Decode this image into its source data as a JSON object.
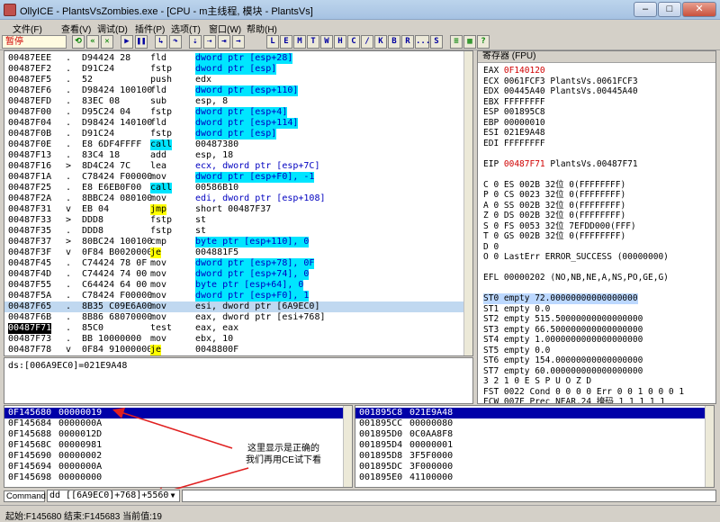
{
  "window": {
    "title": "OllyICE - PlantsVsZombies.exe - [CPU - m主线程, 模块 - PlantsVs]",
    "minimize": "–",
    "maximize": "□",
    "close": "✕"
  },
  "menu": [
    "文件(F)",
    "查看(V)",
    "调试(D)",
    "插件(P)",
    "选项(T)",
    "窗口(W)",
    "帮助(H)"
  ],
  "toolbar": {
    "status": "暂停",
    "letter_buttons": [
      "L",
      "E",
      "M",
      "T",
      "W",
      "H",
      "C",
      "/",
      "K",
      "B",
      "R",
      "...",
      "S"
    ]
  },
  "disasm": [
    {
      "addr": "00487EEE",
      "mark": ".",
      "hex": "D94424 28",
      "mn": "fld",
      "op": "dword ptr [esp+28]",
      "hl": "cyan"
    },
    {
      "addr": "00487EF2",
      "mark": ".",
      "hex": "D91C24",
      "mn": "fstp",
      "op": "dword ptr [esp]",
      "hl": "cyan"
    },
    {
      "addr": "00487EF5",
      "mark": ".",
      "hex": "52",
      "mn": "push",
      "op": "edx",
      "hl": ""
    },
    {
      "addr": "00487EF6",
      "mark": ".",
      "hex": "D98424 100100",
      "mn": "fld",
      "op": "dword ptr [esp+110]",
      "hl": "cyan"
    },
    {
      "addr": "00487EFD",
      "mark": ".",
      "hex": "83EC 08",
      "mn": "sub",
      "op": "esp, 8",
      "hl": ""
    },
    {
      "addr": "00487F00",
      "mark": ".",
      "hex": "D95C24 04",
      "mn": "fstp",
      "op": "dword ptr [esp+4]",
      "hl": "cyan"
    },
    {
      "addr": "00487F04",
      "mark": ".",
      "hex": "D98424 140100",
      "mn": "fld",
      "op": "dword ptr [esp+114]",
      "hl": "cyan"
    },
    {
      "addr": "00487F0B",
      "mark": ".",
      "hex": "D91C24",
      "mn": "fstp",
      "op": "dword ptr [esp]",
      "hl": "cyan"
    },
    {
      "addr": "00487F0E",
      "mark": ".",
      "hex": "E8 6DF4FFFF",
      "mn": "call",
      "op": "00487380",
      "hl": "",
      "mnhl": "cyan"
    },
    {
      "addr": "00487F13",
      "mark": ".",
      "hex": "83C4 18",
      "mn": "add",
      "op": "esp, 18",
      "hl": ""
    },
    {
      "addr": "00487F16",
      "mark": ">",
      "hex": "8D4C24 7C",
      "mn": "lea",
      "op": "ecx, dword ptr [esp+7C]",
      "hl": "cyanpart"
    },
    {
      "addr": "00487F1A",
      "mark": ".",
      "hex": "C78424 F00000",
      "mn": "mov",
      "op": "dword ptr [esp+F0], -1",
      "hl": "cyan"
    },
    {
      "addr": "00487F25",
      "mark": ".",
      "hex": "E8 E6EB0F00",
      "mn": "call",
      "op": "00586B10",
      "hl": "",
      "mnhl": "cyan"
    },
    {
      "addr": "00487F2A",
      "mark": ".",
      "hex": "8BBC24 080100",
      "mn": "mov",
      "op": "edi, dword ptr [esp+108]",
      "hl": "cyanpart"
    },
    {
      "addr": "00487F31",
      "mark": "v",
      "hex": "EB 04",
      "mn": "jmp",
      "op": "short 00487F37",
      "hl": "",
      "mnhl": "yellow"
    },
    {
      "addr": "00487F33",
      "mark": ">",
      "hex": "DDD8",
      "mn": "fstp",
      "op": "st",
      "hl": ""
    },
    {
      "addr": "00487F35",
      "mark": ".",
      "hex": "DDD8",
      "mn": "fstp",
      "op": "st",
      "hl": ""
    },
    {
      "addr": "00487F37",
      "mark": ">",
      "hex": "80BC24 100100",
      "mn": "cmp",
      "op": "byte ptr [esp+110], 0",
      "hl": "cyan"
    },
    {
      "addr": "00487F3F",
      "mark": "v",
      "hex": "0F84 B0020000",
      "mn": "je",
      "op": "004881F5",
      "hl": "",
      "mnhl": "yellow"
    },
    {
      "addr": "00487F45",
      "mark": ".",
      "hex": "C74424 78 0F",
      "mn": "mov",
      "op": "dword ptr [esp+78], 0F",
      "hl": "cyan"
    },
    {
      "addr": "00487F4D",
      "mark": ".",
      "hex": "C74424 74 00",
      "mn": "mov",
      "op": "dword ptr [esp+74], 0",
      "hl": "cyan"
    },
    {
      "addr": "00487F55",
      "mark": ".",
      "hex": "C64424 64 00",
      "mn": "mov",
      "op": "byte ptr [esp+64], 0",
      "hl": "cyan"
    },
    {
      "addr": "00487F5A",
      "mark": ".",
      "hex": "C78424 F00000",
      "mn": "mov",
      "op": "dword ptr [esp+F0], 1",
      "hl": "cyan"
    },
    {
      "addr": "00487F65",
      "mark": ".",
      "hex": "8B35 C09E6A00",
      "mn": "mov",
      "op": "esi, dword ptr [6A9EC0]",
      "hl": "selected"
    },
    {
      "addr": "00487F6B",
      "mark": ".",
      "hex": "8B86 68070000",
      "mn": "mov",
      "op": "eax, dword ptr [esi+768]",
      "hl": ""
    },
    {
      "addr": "00487F71",
      "mark": ".",
      "hex": "85C0",
      "mn": "test",
      "op": "eax, eax",
      "hl": "",
      "addrhl": "black"
    },
    {
      "addr": "00487F73",
      "mark": ".",
      "hex": "BB 10000000",
      "mn": "mov",
      "op": "ebx, 10",
      "hl": ""
    },
    {
      "addr": "00487F78",
      "mark": "v",
      "hex": "0F84 91000000",
      "mn": "je",
      "op": "0048800F",
      "hl": "",
      "mnhl": "yellow"
    }
  ],
  "info_line": "ds:[006A9EC0]=021E9A48",
  "registers": {
    "header": "寄存器 (FPU)",
    "lines": [
      {
        "t": "EAX 0F140120",
        "red": "0F140120"
      },
      {
        "t": "ECX 0061FCF3 PlantsVs.0061FCF3"
      },
      {
        "t": "EDX 00445A40 PlantsVs.00445A40"
      },
      {
        "t": "EBX FFFFFFFF"
      },
      {
        "t": "ESP 001895C8"
      },
      {
        "t": "EBP 00000010"
      },
      {
        "t": "ESI 021E9A48"
      },
      {
        "t": "EDI FFFFFFFF"
      },
      {
        "t": ""
      },
      {
        "t": "EIP 00487F71 PlantsVs.00487F71",
        "red": "00487F71"
      },
      {
        "t": ""
      },
      {
        "t": "C 0   ES 002B 32位 0(FFFFFFFF)"
      },
      {
        "t": "P 0   CS 0023 32位 0(FFFFFFFF)"
      },
      {
        "t": "A 0   SS 002B 32位 0(FFFFFFFF)"
      },
      {
        "t": "Z 0   DS 002B 32位 0(FFFFFFFF)"
      },
      {
        "t": "S 0   FS 0053 32位 7EFDD000(FFF)"
      },
      {
        "t": "T 0   GS 002B 32位 0(FFFFFFFF)"
      },
      {
        "t": "D 0"
      },
      {
        "t": "O 0   LastErr ERROR_SUCCESS (00000000)"
      },
      {
        "t": ""
      },
      {
        "t": "EFL 00000202 (NO,NB,NE,A,NS,PO,GE,G)"
      },
      {
        "t": ""
      },
      {
        "t": "ST0 empty 72.00000000000000000",
        "hl": true
      },
      {
        "t": "ST1 empty 0.0"
      },
      {
        "t": "ST2 empty 515.50000000000000000"
      },
      {
        "t": "ST3 empty 66.500000000000000000"
      },
      {
        "t": "ST4 empty 1.0000000000000000000"
      },
      {
        "t": "ST5 empty 0.0"
      },
      {
        "t": "ST6 empty 154.00000000000000000"
      },
      {
        "t": "ST7 empty 60.000000000000000000"
      },
      {
        "t": "               3 2 1 0      E S P U O Z D"
      },
      {
        "t": "FST 0022  Cond 0 0 0 0  Err 0 0 1 0 0 0 1"
      },
      {
        "t": "FCW 007F  Prec NEAR,24  掩码    1 1 1 1 1"
      }
    ]
  },
  "dump": [
    {
      "a": "0F145680",
      "v": "00000019",
      "sel": true
    },
    {
      "a": "0F145684",
      "v": "0000000A"
    },
    {
      "a": "0F145688",
      "v": "0000012D"
    },
    {
      "a": "0F14568C",
      "v": "00000981"
    },
    {
      "a": "0F145690",
      "v": "00000002"
    },
    {
      "a": "0F145694",
      "v": "0000000A"
    },
    {
      "a": "0F145698",
      "v": "00000000"
    }
  ],
  "stack": [
    {
      "a": "001895C8",
      "v": "021E9A48",
      "sel": true
    },
    {
      "a": "001895CC",
      "v": "00000080"
    },
    {
      "a": "001895D0",
      "v": "0C0AA8F8"
    },
    {
      "a": "001895D4",
      "v": "00000001"
    },
    {
      "a": "001895D8",
      "v": "3F5F0000"
    },
    {
      "a": "001895DC",
      "v": "3F000000"
    },
    {
      "a": "001895E0",
      "v": "41100000"
    }
  ],
  "annotation": {
    "line1": "这里显示是正确的",
    "line2": "我们再用CE试下看",
    "arrow_color": "#e02020"
  },
  "command": {
    "label": "Command",
    "value": "dd [[6A9EC0]+768]+5560"
  },
  "status": "起始:F145680  结束:F145683  当前值:19"
}
